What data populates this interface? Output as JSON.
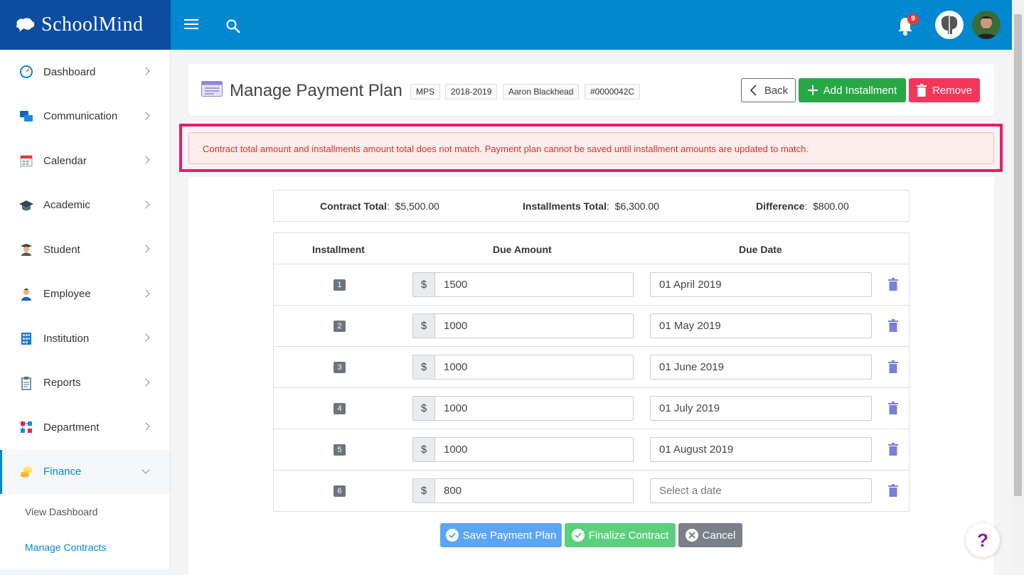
{
  "brand": {
    "name": "SchoolMind"
  },
  "header": {
    "notification_count": "9"
  },
  "sidebar": {
    "items": [
      {
        "label": "Dashboard"
      },
      {
        "label": "Communication"
      },
      {
        "label": "Calendar"
      },
      {
        "label": "Academic"
      },
      {
        "label": "Student"
      },
      {
        "label": "Employee"
      },
      {
        "label": "Institution"
      },
      {
        "label": "Reports"
      },
      {
        "label": "Department"
      },
      {
        "label": "Finance"
      }
    ],
    "finance_sub": [
      {
        "label": "View Dashboard"
      },
      {
        "label": "Manage Contracts"
      }
    ]
  },
  "page": {
    "title": "Manage Payment Plan",
    "tags": [
      "MPS",
      "2018-2019",
      "Aaron Blackhead",
      "#0000042C"
    ],
    "back_label": "Back",
    "add_label": "Add Installment",
    "remove_label": "Remove"
  },
  "alert": {
    "message": "Contract total amount and installments amount total does not match. Payment plan cannot be saved until installment amounts are updated to match."
  },
  "totals": {
    "contract_label": "Contract Total",
    "contract_value": "$5,500.00",
    "installments_label": "Installments Total",
    "installments_value": "$6,300.00",
    "difference_label": "Difference",
    "difference_value": "$800.00"
  },
  "table": {
    "headers": {
      "installment": "Installment",
      "amount": "Due Amount",
      "date": "Due Date"
    },
    "currency": "$",
    "date_placeholder": "Select a date",
    "rows": [
      {
        "num": "1",
        "amount": "1500",
        "date": "01 April 2019"
      },
      {
        "num": "2",
        "amount": "1000",
        "date": "01 May 2019"
      },
      {
        "num": "3",
        "amount": "1000",
        "date": "01 June 2019"
      },
      {
        "num": "4",
        "amount": "1000",
        "date": "01 July 2019"
      },
      {
        "num": "5",
        "amount": "1000",
        "date": "01 August 2019"
      },
      {
        "num": "6",
        "amount": "800",
        "date": ""
      }
    ]
  },
  "actions": {
    "save_label": "Save Payment Plan",
    "finalize_label": "Finalize Contract",
    "cancel_label": "Cancel"
  },
  "help": {
    "label": "?"
  }
}
